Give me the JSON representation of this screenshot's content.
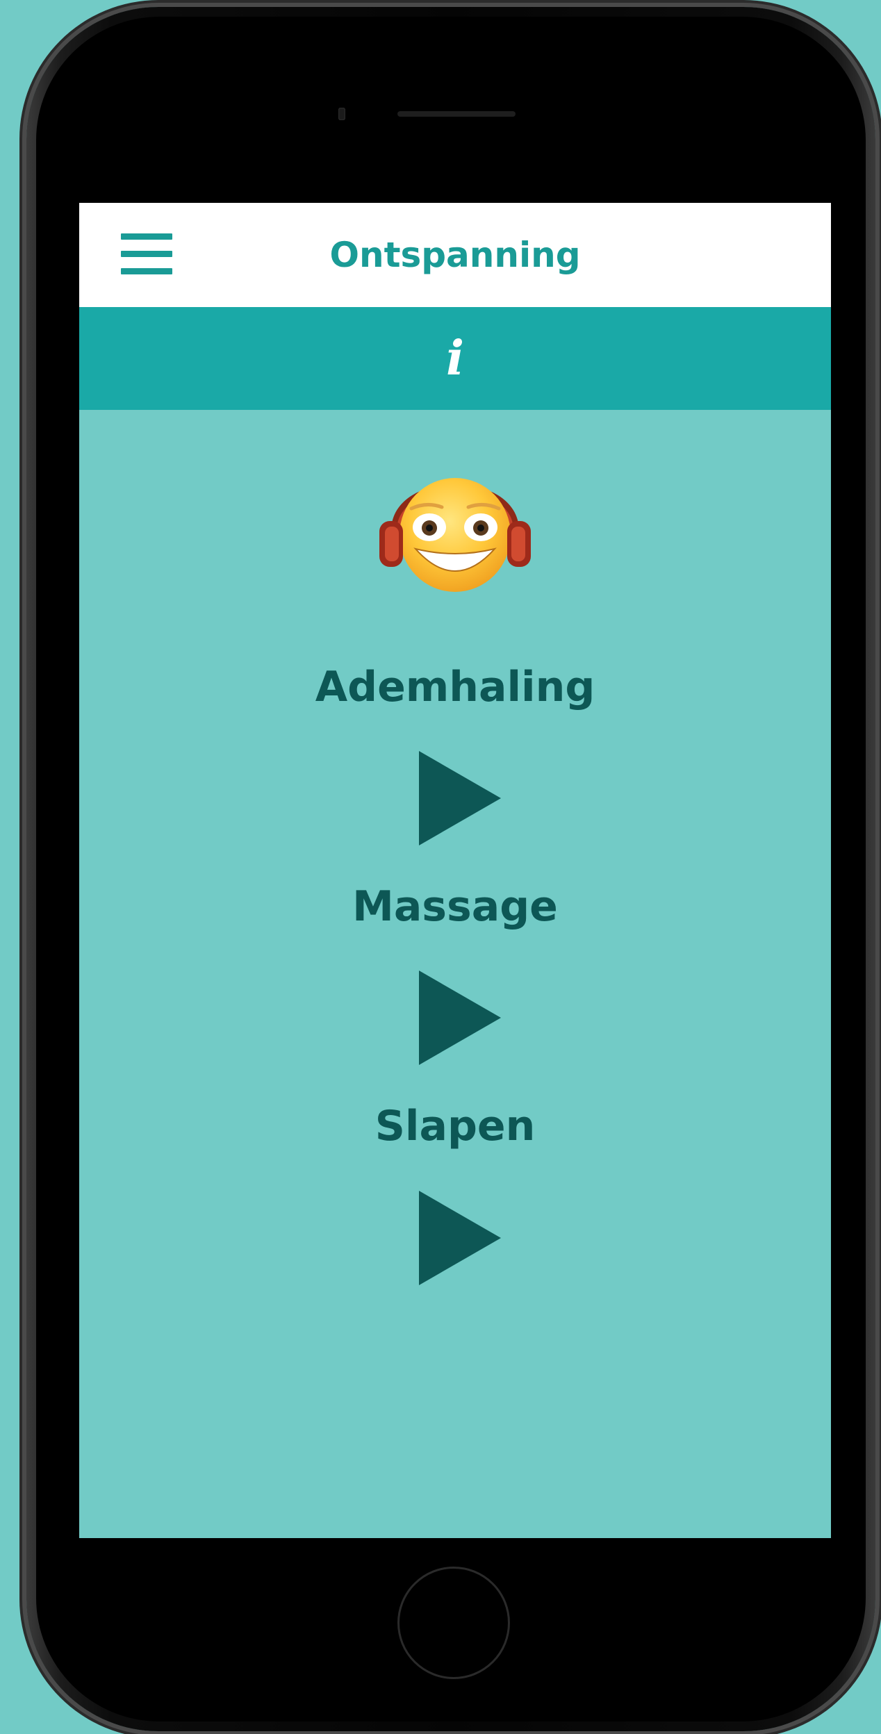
{
  "header": {
    "title": "Ontspanning",
    "menu_icon": "hamburger-menu-icon"
  },
  "info_bar": {
    "icon": "info-icon",
    "glyph": "i"
  },
  "avatar": {
    "icon": "smiley-headphones-icon"
  },
  "sections": [
    {
      "label": "Ademhaling",
      "play_icon": "play-icon"
    },
    {
      "label": "Massage",
      "play_icon": "play-icon"
    },
    {
      "label": "Slapen",
      "play_icon": "play-icon"
    }
  ],
  "colors": {
    "background": "#72cbc6",
    "accent": "#1a9b96",
    "info_bar": "#1aa9a7",
    "dark_text": "#0d5755",
    "header_bg": "#ffffff"
  }
}
